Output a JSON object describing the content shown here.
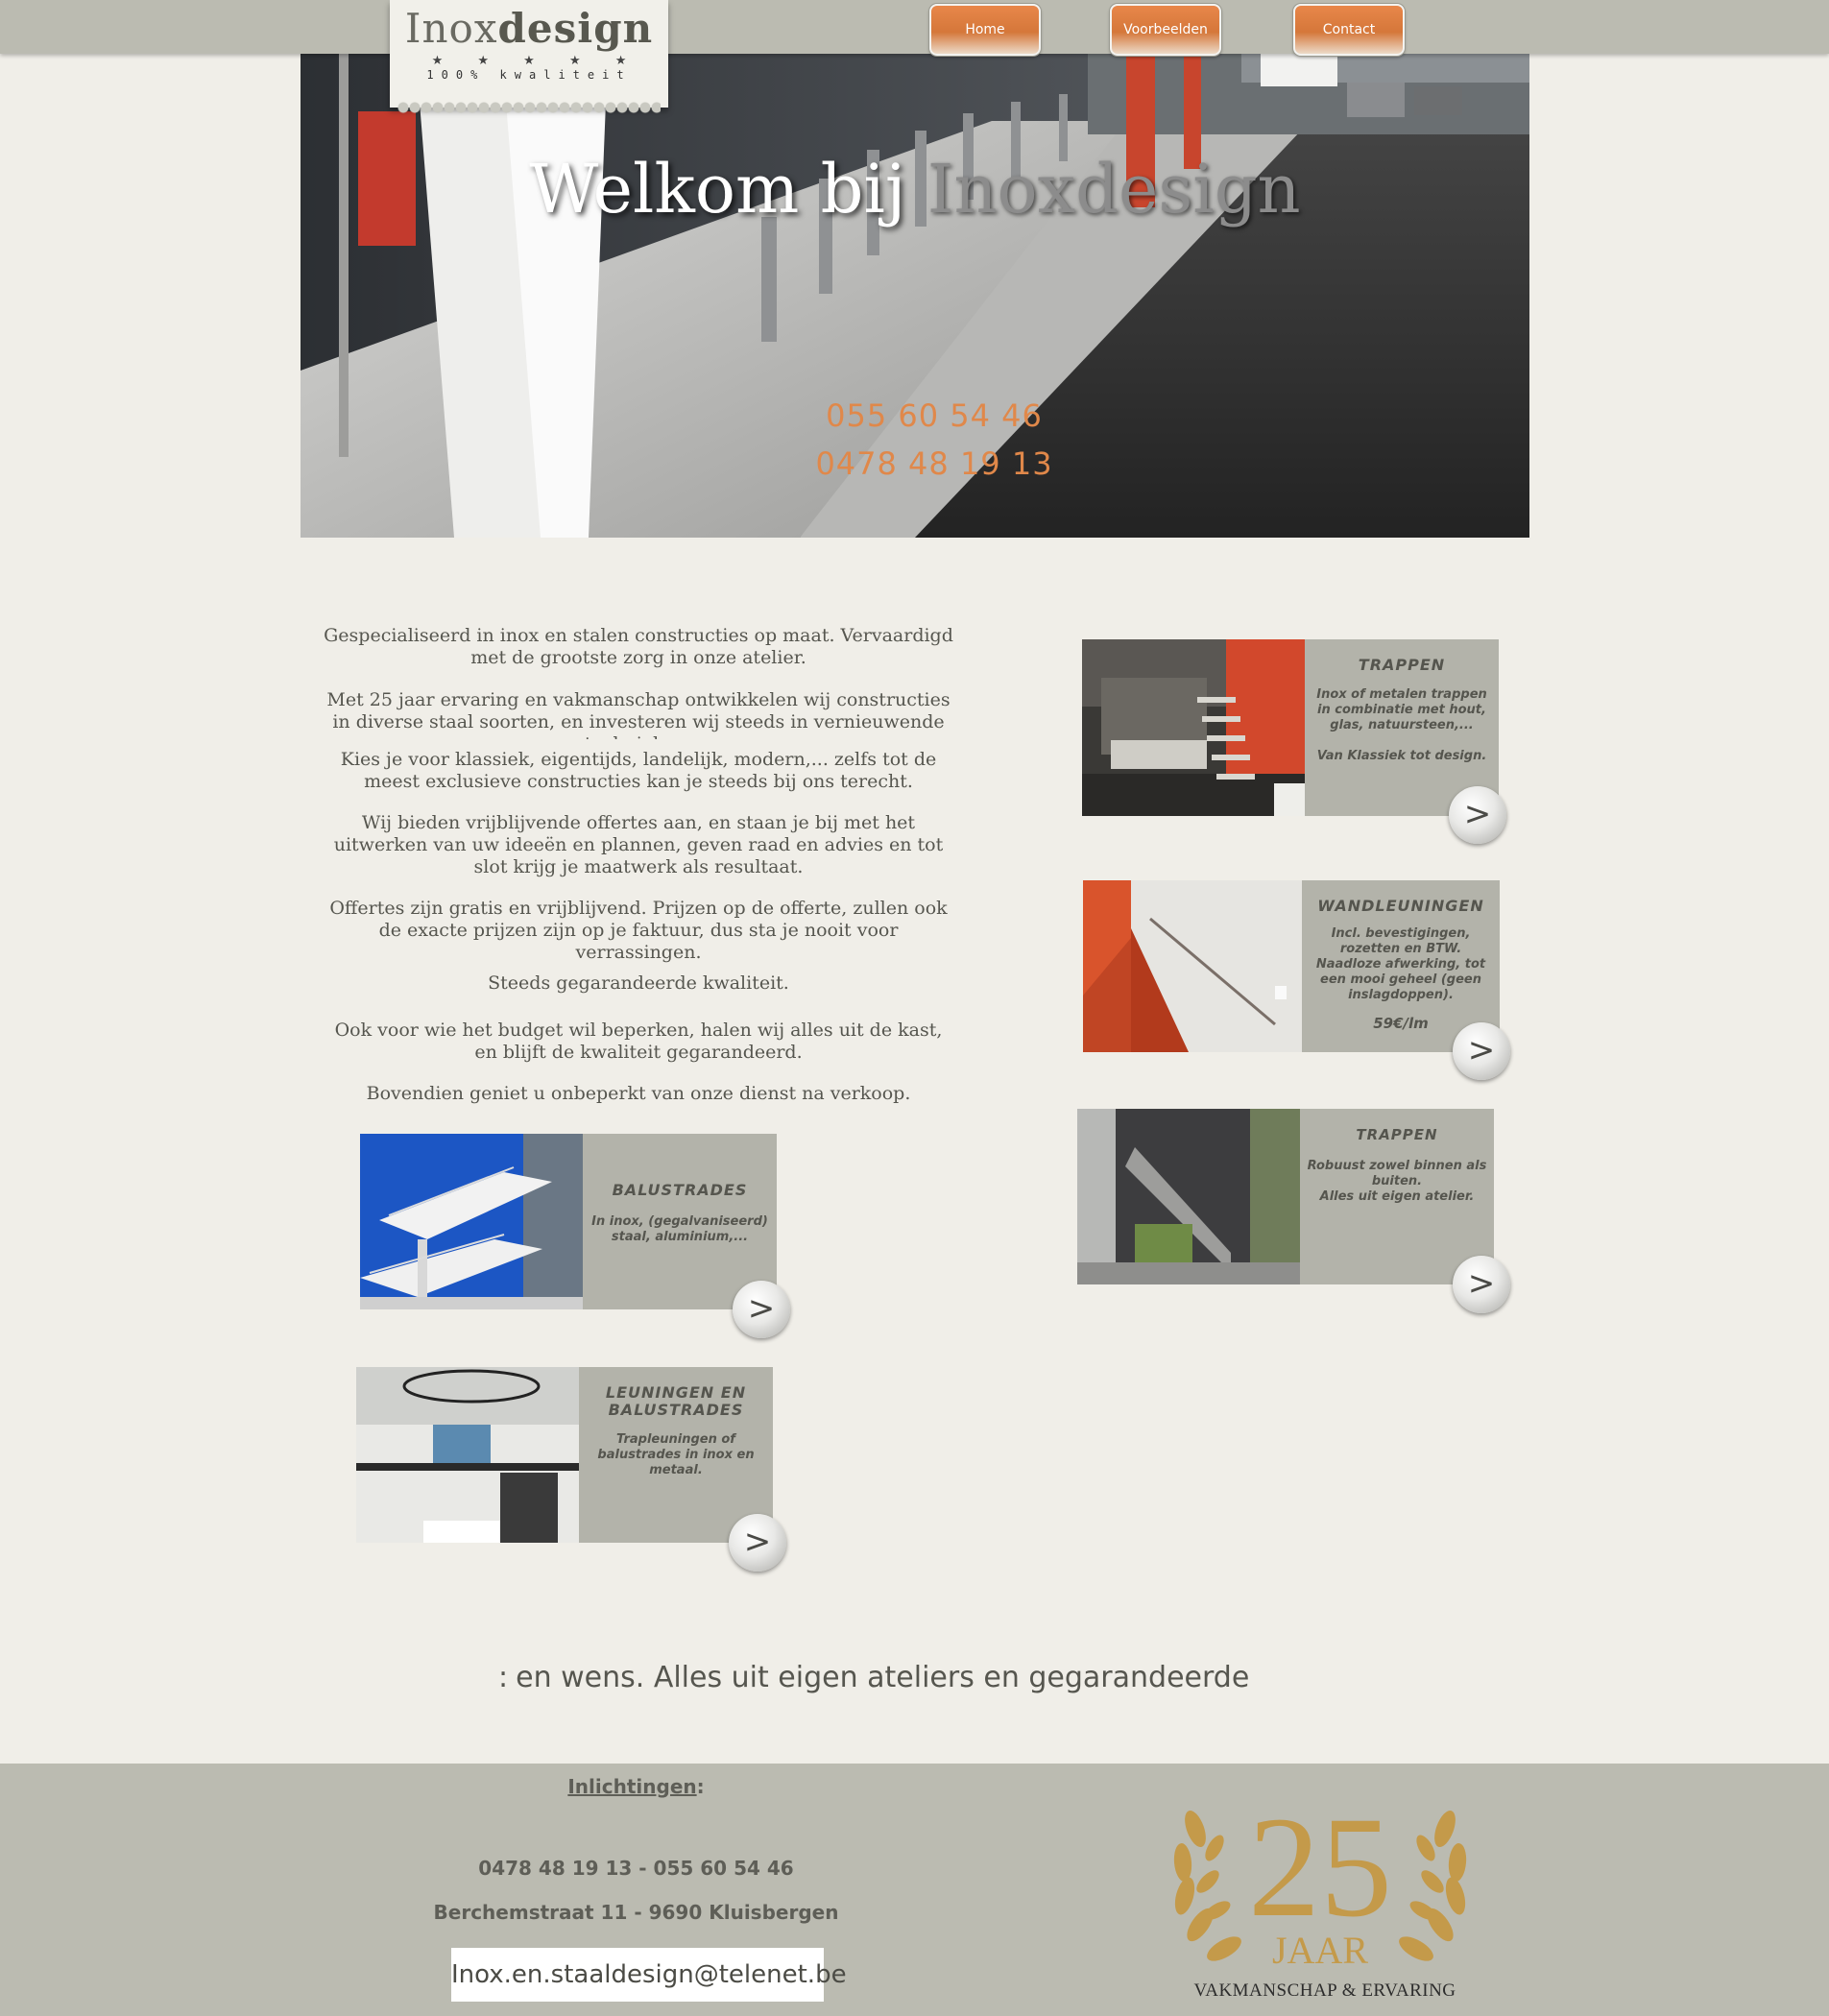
{
  "logo": {
    "name_light": "Inox",
    "name_bold": "design",
    "stars": "★ ★ ★ ★ ★",
    "tagline": "100% kwaliteit"
  },
  "nav": {
    "items": [
      {
        "label": "Home"
      },
      {
        "label": "Voorbeelden"
      },
      {
        "label": "Contact"
      }
    ]
  },
  "hero": {
    "title_part1": "Welkom bij ",
    "title_part2": "Inoxdesign",
    "phone1": "055 60 54 46",
    "phone2": "0478 48 19 13"
  },
  "intro": {
    "p1": "Gespecialiseerd in inox en stalen constructies op maat.  Vervaardigd met de grootste zorg in onze atelier.",
    "p2": "Met 25 jaar ervaring en vakmanschap ontwikkelen wij constructies in diverse staal soorten, en investeren wij steeds in vernieuwende technieken.",
    "p3": "Kies je voor klassiek, eigentijds, landelijk, modern,... zelfs tot de meest exclusieve constructies kan je steeds bij ons terecht.",
    "p4": "Wij bieden vrijblijvende offertes aan, en staan je bij met het uitwerken van uw ideeën en plannen, geven raad en advies en tot slot krijg je maatwerk als resultaat.",
    "p5": "Offertes zijn gratis en vrijblijvend.  Prijzen op de offerte, zullen ook de exacte prijzen zijn op je faktuur, dus sta je nooit voor verrassingen.",
    "p6": "Steeds gegarandeerde kwaliteit.",
    "p7": "Ook voor wie het budget wil beperken, halen wij alles uit de kast, en blijft de kwaliteit gegarandeerd.",
    "p8": "Bovendien geniet u onbeperkt van onze dienst na verkoop."
  },
  "cards": {
    "trappen1": {
      "title": "TRAPPEN",
      "desc": "Inox of metalen trappen in combinatie met hout, glas, natuursteen,...\n\nVan Klassiek tot design.",
      "arrow": ">"
    },
    "wandleuningen": {
      "title": "WANDLEUNINGEN",
      "desc": "Incl. bevestigingen, rozetten en BTW.\nNaadloze afwerking, tot een mooi geheel (geen inslagdoppen).",
      "price": "59€/lm",
      "arrow": ">"
    },
    "trappen2": {
      "title": "TRAPPEN",
      "desc": "Robuust zowel binnen als buiten.\nAlles uit eigen atelier.",
      "arrow": ">"
    },
    "balustrades": {
      "title": "BALUSTRADES",
      "desc": "In inox, (gegalvaniseerd) staal, aluminium,...",
      "arrow": ">"
    },
    "leuningen": {
      "title": "LEUNINGEN EN BALUSTRADES",
      "desc": "Trapleuningen of balustrades in inox en metaal.",
      "arrow": ">"
    }
  },
  "marquee": {
    "text": "en wens.  Alles uit eigen ateliers en gegarandeerde"
  },
  "footer": {
    "heading": "Inlichtingen",
    "heading_suffix": ":",
    "phones": "0478 48 19 13 - 055 60 54 46",
    "address": "Berchemstraat 11 - 9690 Kluisbergen",
    "email": "Inox.en.staaldesign@telenet.be",
    "badge_number": "25",
    "badge_word": "JAAR",
    "badge_caption": "VAKMANSCHAP & ERVARING"
  },
  "colors": {
    "accent": "#e0884a",
    "bar": "#bbbbb1",
    "card": "#b3b3aa",
    "gold": "#c49a4a"
  }
}
